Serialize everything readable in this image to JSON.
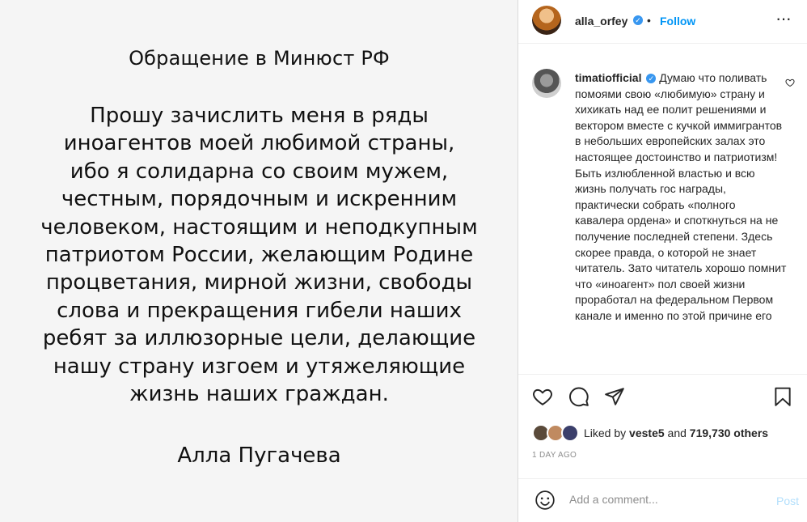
{
  "image": {
    "title": "Обращение в Минюст РФ",
    "body_lines": [
      "Прошу зачислить меня в ряды",
      "иноагентов моей любимой страны,",
      "ибо я солидарна со своим мужем,",
      "честным, порядочным и искренним",
      "человеком, настоящим и неподкупным",
      "патриотом России, желающим Родине",
      "процветания, мирной жизни, свободы",
      "слова и прекращения гибели наших",
      "ребят за иллюзорные цели, делающие",
      "нашу страну изгоем и утяжеляющие",
      "жизнь наших граждан."
    ],
    "signature": "Алла Пугачева"
  },
  "header": {
    "username": "alla_orfey",
    "separator": "•",
    "follow_label": "Follow",
    "more_label": "···"
  },
  "comment": {
    "username": "timatiofficial",
    "text": "Думаю что поливать помоями свою «любимую» страну и хихикать над ее полит решениями и вектором вместе с кучкой иммигрантов в небольших европейских залах это настоящее достоинство и патриотизм! Быть излюбленной властью и всю жизнь получать гос награды, практически собрать «полного кавалера ордена» и споткнуться на не получение последней степени. Здесь скорее правда, о которой не знает читатель. Зато читатель хорошо помнит что «иноагент» пол своей жизни проработал на федеральном Первом канале и именно по этой причине его"
  },
  "likes": {
    "prefix": "Liked by ",
    "user": "veste5",
    "middle": " and ",
    "count": "719,730 others"
  },
  "timestamp": "1 DAY AGO",
  "add_comment": {
    "placeholder": "Add a comment...",
    "post_label": "Post"
  },
  "colors": {
    "accent": "#0095f6",
    "verified": "#3897f0",
    "post_disabled": "#b2dffc",
    "muted": "#8e8e8e"
  },
  "icons": [
    "verified-icon",
    "more-icon",
    "heart-icon",
    "comment-icon",
    "share-icon",
    "bookmark-icon",
    "emoji-icon"
  ]
}
